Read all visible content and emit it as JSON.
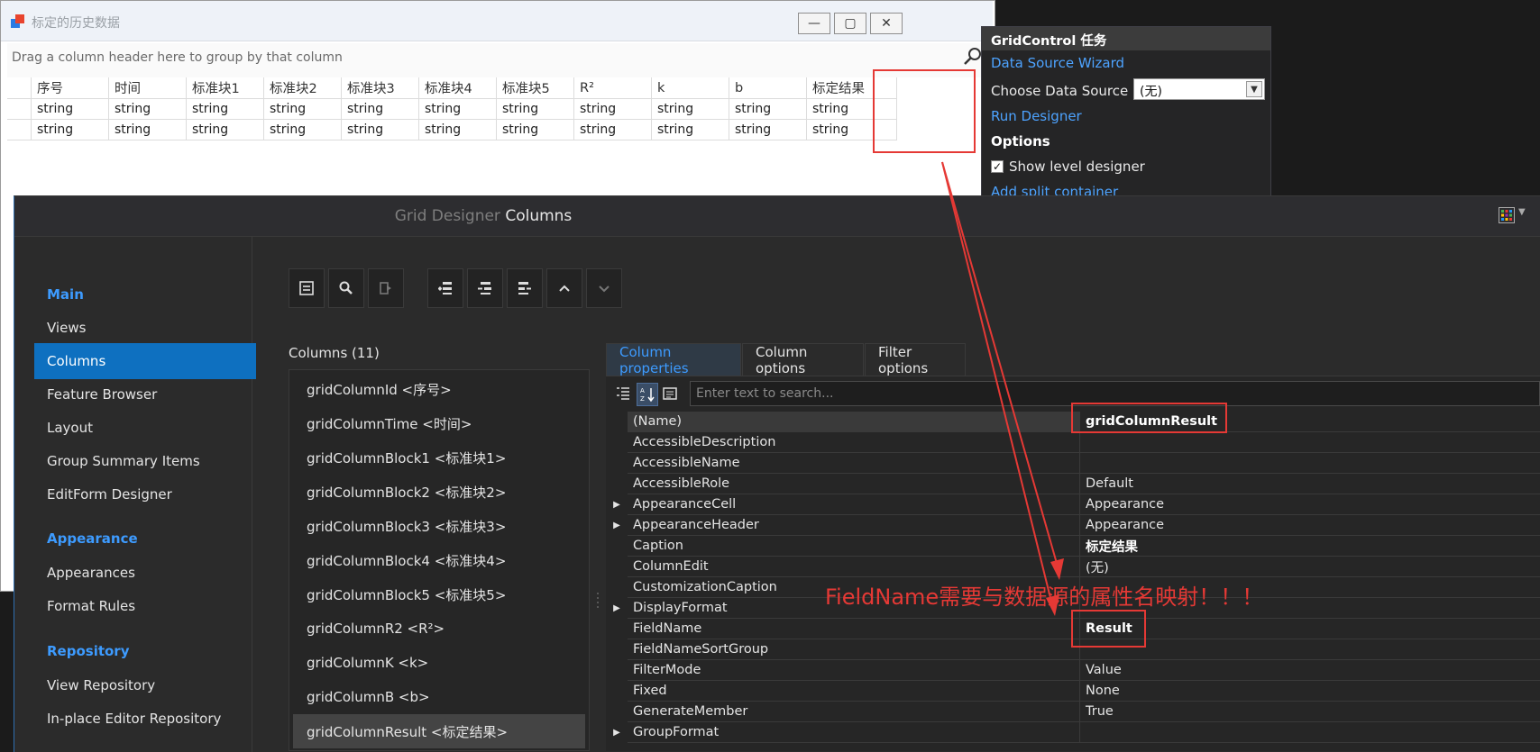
{
  "form": {
    "title": "标定的历史数据",
    "group_panel_text": "Drag a column header here to group by that column",
    "columns": [
      "序号",
      "时间",
      "标准块1",
      "标准块2",
      "标准块3",
      "标准块4",
      "标准块5",
      "R²",
      "k",
      "b",
      "标定结果"
    ],
    "rows": [
      [
        "string",
        "string",
        "string",
        "string",
        "string",
        "string",
        "string",
        "string",
        "string",
        "string",
        "string"
      ],
      [
        "string",
        "string",
        "string",
        "string",
        "string",
        "string",
        "string",
        "string",
        "string",
        "string",
        "string"
      ]
    ],
    "window_buttons": {
      "minimize": "—",
      "maximize": "▢",
      "close": "✕"
    }
  },
  "tasks_panel": {
    "title": "GridControl 任务",
    "data_source_wizard": "Data Source Wizard",
    "choose_data_source_label": "Choose Data Source",
    "choose_data_source_value": "(无)",
    "run_designer": "Run Designer",
    "options_header": "Options",
    "show_level_designer": "Show level designer",
    "show_level_designer_checked": true,
    "add_split_container": "Add split container"
  },
  "designer": {
    "title_prefix": "Grid Designer",
    "title_section": "Columns",
    "nav": {
      "main": "Main",
      "main_items": [
        "Views",
        "Columns",
        "Feature Browser",
        "Layout",
        "Group Summary Items",
        "EditForm Designer"
      ],
      "appearance": "Appearance",
      "appearance_items": [
        "Appearances",
        "Format Rules"
      ],
      "repository": "Repository",
      "repository_items": [
        "View Repository",
        "In-place Editor Repository"
      ],
      "selected": "Columns"
    },
    "columns_label": "Columns (11)",
    "columns_list": [
      "gridColumnId <序号>",
      "gridColumnTime <时间>",
      "gridColumnBlock1 <标准块1>",
      "gridColumnBlock2 <标准块2>",
      "gridColumnBlock3 <标准块3>",
      "gridColumnBlock4 <标准块4>",
      "gridColumnBlock5 <标准块5>",
      "gridColumnR2 <R²>",
      "gridColumnK <k>",
      "gridColumnB <b>",
      "gridColumnResult <标定结果>"
    ],
    "selected_column": "gridColumnResult <标定结果>",
    "property_tabs": [
      "Column properties",
      "Column options",
      "Filter options"
    ],
    "search_placeholder": "Enter text to search...",
    "properties": [
      {
        "name": "(Name)",
        "value": "gridColumnResult",
        "bold": true,
        "expandable": false
      },
      {
        "name": "AccessibleDescription",
        "value": "",
        "bold": false,
        "expandable": false
      },
      {
        "name": "AccessibleName",
        "value": "",
        "bold": false,
        "expandable": false
      },
      {
        "name": "AccessibleRole",
        "value": "Default",
        "bold": false,
        "expandable": false
      },
      {
        "name": "AppearanceCell",
        "value": "Appearance",
        "bold": false,
        "expandable": true
      },
      {
        "name": "AppearanceHeader",
        "value": "Appearance",
        "bold": false,
        "expandable": true
      },
      {
        "name": "Caption",
        "value": "标定结果",
        "bold": true,
        "expandable": false
      },
      {
        "name": "ColumnEdit",
        "value": "(无)",
        "bold": false,
        "expandable": false
      },
      {
        "name": "CustomizationCaption",
        "value": "",
        "bold": false,
        "expandable": false
      },
      {
        "name": "DisplayFormat",
        "value": "",
        "bold": false,
        "expandable": true
      },
      {
        "name": "FieldName",
        "value": "Result",
        "bold": true,
        "expandable": false
      },
      {
        "name": "FieldNameSortGroup",
        "value": "",
        "bold": false,
        "expandable": false
      },
      {
        "name": "FilterMode",
        "value": "Value",
        "bold": false,
        "expandable": false
      },
      {
        "name": "Fixed",
        "value": "None",
        "bold": false,
        "expandable": false
      },
      {
        "name": "GenerateMember",
        "value": "True",
        "bold": false,
        "expandable": false
      },
      {
        "name": "GroupFormat",
        "value": "",
        "bold": false,
        "expandable": true
      }
    ]
  },
  "annotation": {
    "note": "FieldName需要与数据源的属性名映射！！！",
    "color": "#e53935"
  },
  "colors": {
    "accent": "#3d9bff",
    "selected_nav": "#0e70c0",
    "designer_bg": "#2b2b2b",
    "annotation_red": "#e53935"
  }
}
